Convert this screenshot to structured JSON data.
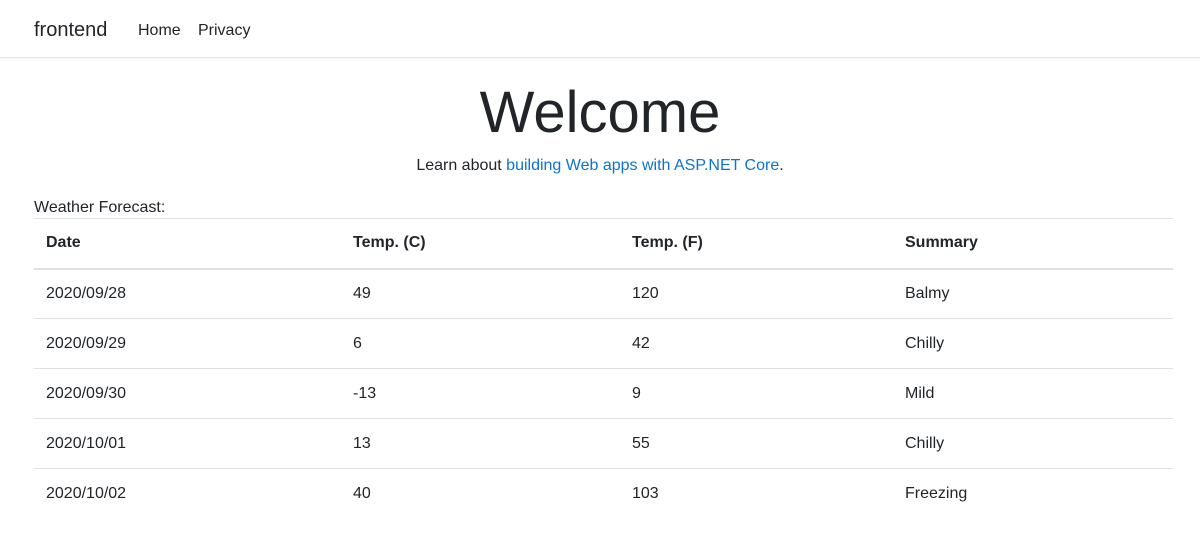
{
  "nav": {
    "brand": "frontend",
    "links": [
      {
        "label": "Home"
      },
      {
        "label": "Privacy"
      }
    ]
  },
  "main": {
    "title": "Welcome",
    "learn_prefix": "Learn about ",
    "learn_link": "building Web apps with ASP.NET Core",
    "learn_suffix": ".",
    "forecast_label": "Weather Forecast:",
    "table": {
      "headers": [
        "Date",
        "Temp. (C)",
        "Temp. (F)",
        "Summary"
      ],
      "rows": [
        [
          "2020/09/28",
          "49",
          "120",
          "Balmy"
        ],
        [
          "2020/09/29",
          "6",
          "42",
          "Chilly"
        ],
        [
          "2020/09/30",
          "-13",
          "9",
          "Mild"
        ],
        [
          "2020/10/01",
          "13",
          "55",
          "Chilly"
        ],
        [
          "2020/10/02",
          "40",
          "103",
          "Freezing"
        ]
      ]
    }
  },
  "colors": {
    "link": "#0b74d1",
    "text": "#212529",
    "border": "#dee2e6"
  }
}
